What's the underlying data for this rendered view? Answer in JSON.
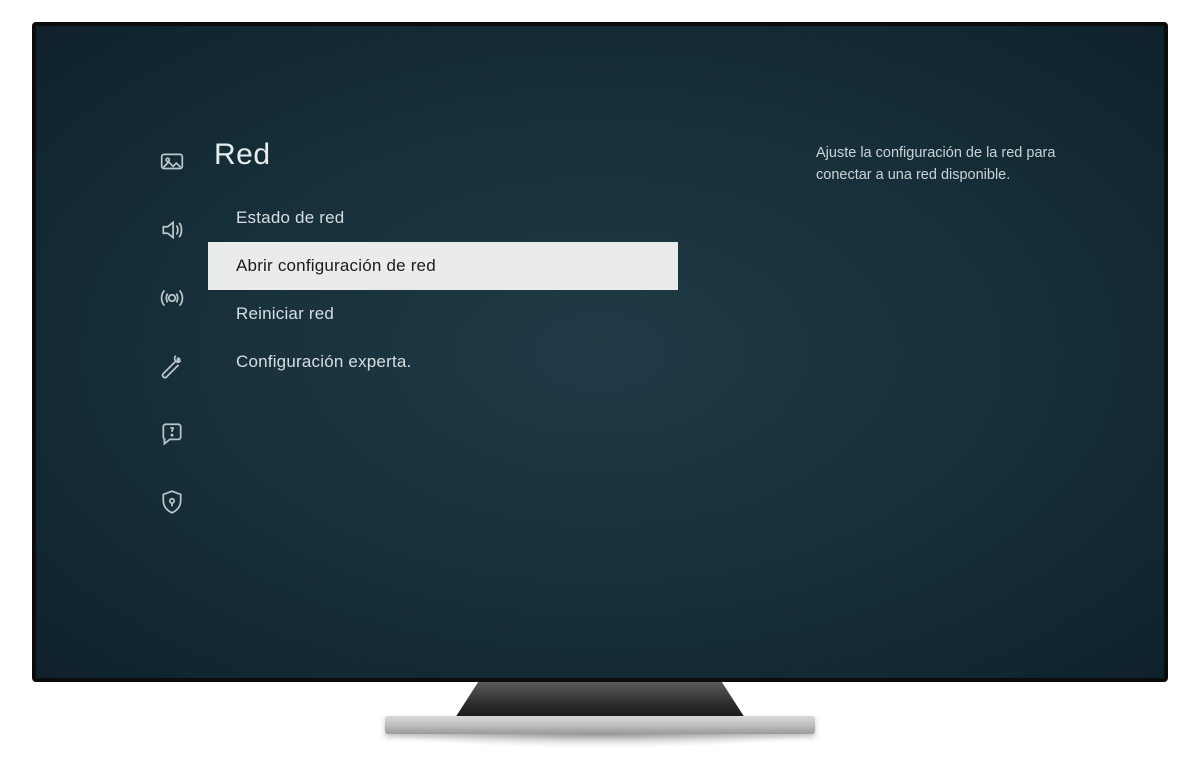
{
  "section": {
    "title": "Red"
  },
  "options": [
    {
      "label": "Estado de red",
      "selected": false
    },
    {
      "label": "Abrir configuración de red",
      "selected": true
    },
    {
      "label": "Reiniciar red",
      "selected": false
    },
    {
      "label": "Configuración experta.",
      "selected": false
    }
  ],
  "description": "Ajuste la configuración de la red para conectar a una red disponible.",
  "sidebar": {
    "items": [
      {
        "name": "picture-icon"
      },
      {
        "name": "sound-icon"
      },
      {
        "name": "broadcast-icon"
      },
      {
        "name": "general-icon"
      },
      {
        "name": "support-icon"
      },
      {
        "name": "privacy-icon"
      }
    ]
  }
}
